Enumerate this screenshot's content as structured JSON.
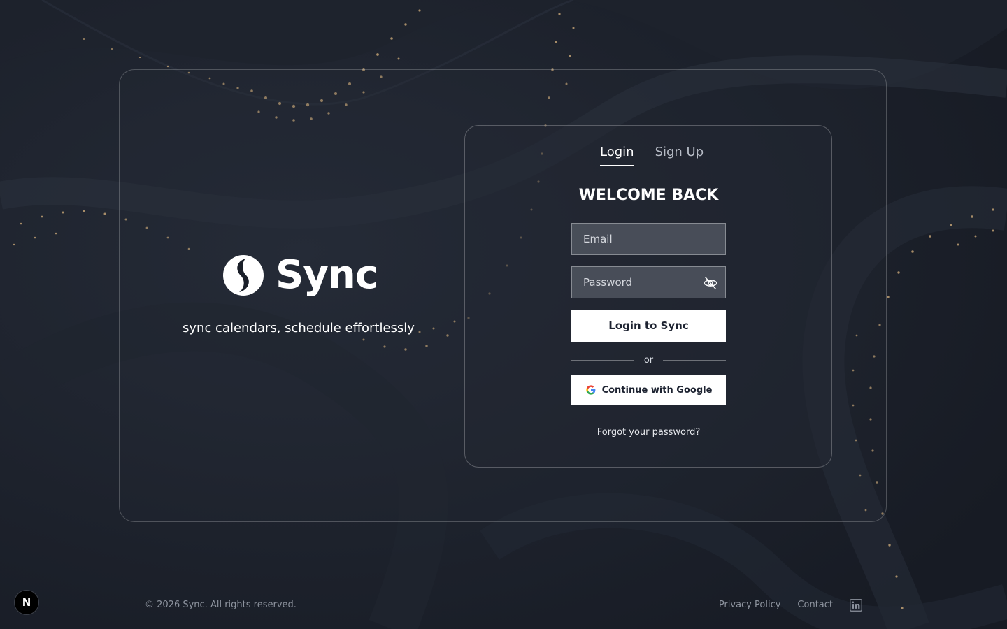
{
  "brand": {
    "name": "Sync",
    "tagline": "sync calendars, schedule effortlessly"
  },
  "auth": {
    "tabs": [
      {
        "label": "Login",
        "active": true
      },
      {
        "label": "Sign Up",
        "active": false
      }
    ],
    "heading": "WELCOME BACK",
    "email_placeholder": "Email",
    "email_value": "",
    "password_placeholder": "Password",
    "password_value": "",
    "password_toggle_icon": "eye-off-icon",
    "submit_label": "Login to Sync",
    "divider_text": "or",
    "google_label": "Continue with Google",
    "forgot_label": "Forgot your password?"
  },
  "footer": {
    "copyright": "© 2026 Sync. All rights reserved.",
    "links": [
      {
        "label": "Privacy Policy"
      },
      {
        "label": "Contact"
      }
    ],
    "social_icon": "linkedin-icon"
  },
  "dev_badge": {
    "label": "N",
    "icon": "nextjs-icon"
  },
  "colors": {
    "background": "#1a1f29",
    "accent_dots": "#c9a777",
    "button_bg": "#ffffff",
    "button_text": "#1c2230",
    "muted_text": "#8d939e"
  }
}
